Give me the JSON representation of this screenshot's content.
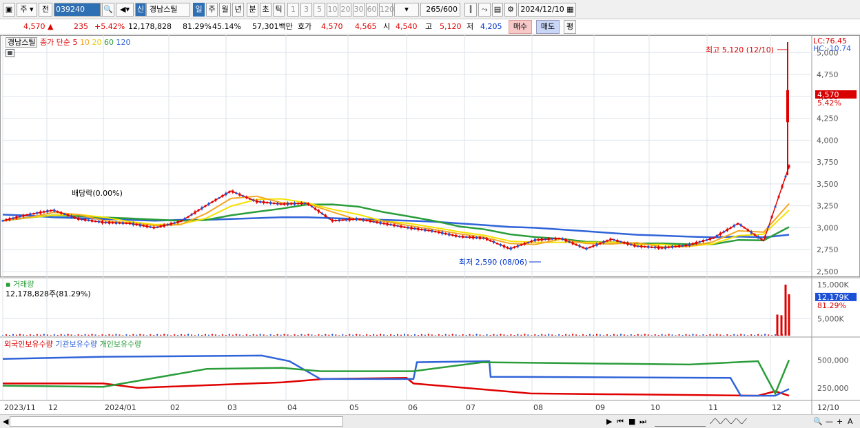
{
  "toolbar": {
    "market": "주",
    "prev": "전",
    "code": "039240",
    "credit_badge": "신",
    "stock_name": "경남스틸",
    "periods": [
      "일",
      "주",
      "월",
      "년",
      "분",
      "초",
      "틱"
    ],
    "active_period": "일",
    "intervals": [
      "1",
      "3",
      "5",
      "10",
      "20",
      "30",
      "60",
      "120"
    ],
    "count": "265",
    "count_max": "/600",
    "date": "2024/12/10"
  },
  "quote": {
    "price": "4,570",
    "change": "235",
    "change_pct": "+5.42%",
    "volume": "12,178,828",
    "vol_ratio": "81.29%",
    "turnover": "45.14%",
    "amount": "57,301백만",
    "bid_label": "호가",
    "ask": "4,570",
    "bid": "4,565",
    "open_label": "시",
    "open": "4,540",
    "high_label": "고",
    "high": "5,120",
    "low_label": "저",
    "low": "4,205",
    "buy_button": "매수",
    "sell_button": "매도",
    "eval_button": "평"
  },
  "price_pane": {
    "legend_name": "경남스틸",
    "legend_ma": "종가 단순",
    "ma_periods": [
      "5",
      "10",
      "20",
      "60",
      "120"
    ],
    "ma_colors": [
      "#e00000",
      "#f5a623",
      "#f5e100",
      "#2a9d3a",
      "#2f63d8"
    ],
    "lc": "LC:76.45",
    "hc": "HC:-10.74",
    "y_ticks": [
      "5,000",
      "4,750",
      "4,500",
      "4,250",
      "4,000",
      "3,750",
      "3,500",
      "3,250",
      "3,000",
      "2,750",
      "2,500"
    ],
    "last_price_tag": "4,570",
    "last_pct_tag": "5.42%",
    "high_annotation": "최고 5,120 (12/10)",
    "low_annotation": "최저 2,590 (08/06)",
    "dividend_annotation": "배당락(0.00%)"
  },
  "volume_pane": {
    "title": "거래량",
    "value_text": "12,178,828주(81.29%)",
    "y_ticks": [
      "15,000K",
      "5,000K"
    ],
    "last_tag": "12,179K",
    "last_pct": "81.29%"
  },
  "holding_pane": {
    "series": [
      "외국인보유수량",
      "기관보유수량",
      "개인보유수량"
    ],
    "y_ticks": [
      "500,000",
      "250,000"
    ]
  },
  "x_axis": {
    "labels": [
      "2023/11",
      "12",
      "2024/01",
      "02",
      "03",
      "04",
      "05",
      "06",
      "07",
      "08",
      "09",
      "10",
      "11",
      "12"
    ],
    "right_label": "12/10"
  },
  "chart_data": {
    "type": "line",
    "title": "경남스틸",
    "series": [
      {
        "name": "5",
        "values": [
          3080,
          3150,
          3200,
          3100,
          3060,
          3050,
          3000,
          3070,
          3250,
          3420,
          3300,
          3270,
          3280,
          3080,
          3100,
          3050,
          3000,
          2960,
          2900,
          2880,
          2760,
          2860,
          2880,
          2760,
          2870,
          2790,
          2770,
          2800,
          2880,
          3050,
          2850,
          3700
        ]
      },
      {
        "name": "120",
        "values": [
          3150,
          3140,
          3120,
          3110,
          3100,
          3090,
          3080,
          3090,
          3090,
          3100,
          3110,
          3120,
          3120,
          3110,
          3100,
          3090,
          3080,
          3070,
          3050,
          3030,
          3010,
          3000,
          2980,
          2960,
          2940,
          2920,
          2910,
          2900,
          2890,
          2900,
          2890,
          2920
        ]
      }
    ],
    "ylim": [
      2500,
      5120
    ],
    "high": 5120,
    "low": 2590,
    "volume_last_k": 12179,
    "holding": [
      {
        "name": "외국인보유수량",
        "color": "#e00000"
      },
      {
        "name": "기관보유수량",
        "color": "#2f63d8"
      },
      {
        "name": "개인보유수량",
        "color": "#2a9d3a"
      }
    ]
  }
}
